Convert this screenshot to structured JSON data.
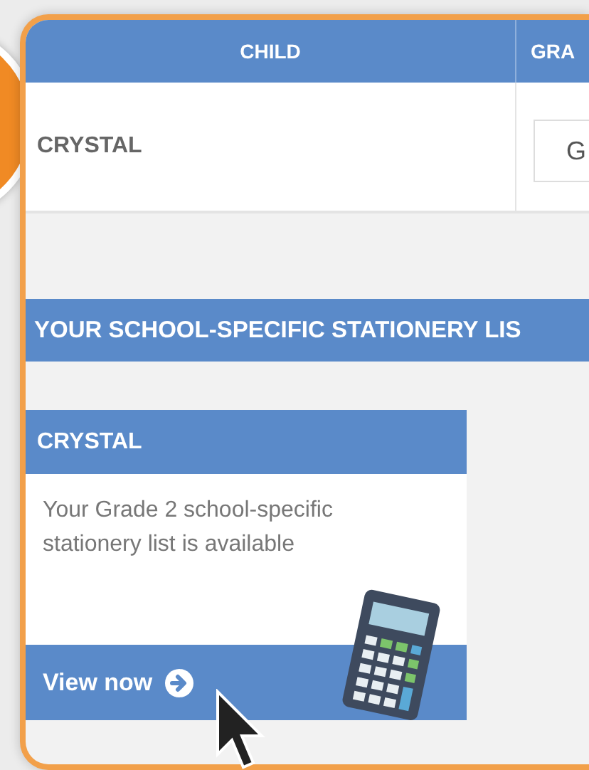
{
  "table": {
    "columns": [
      "CHILD",
      "GRA"
    ],
    "rows": [
      {
        "child": "CRYSTAL",
        "grade_value": "G"
      }
    ]
  },
  "banner": {
    "title": "YOUR SCHOOL-SPECIFIC STATIONERY LIS"
  },
  "card": {
    "title": "CRYSTAL",
    "text": "Your Grade 2 school-specific stationery list is available",
    "link": "View now"
  }
}
